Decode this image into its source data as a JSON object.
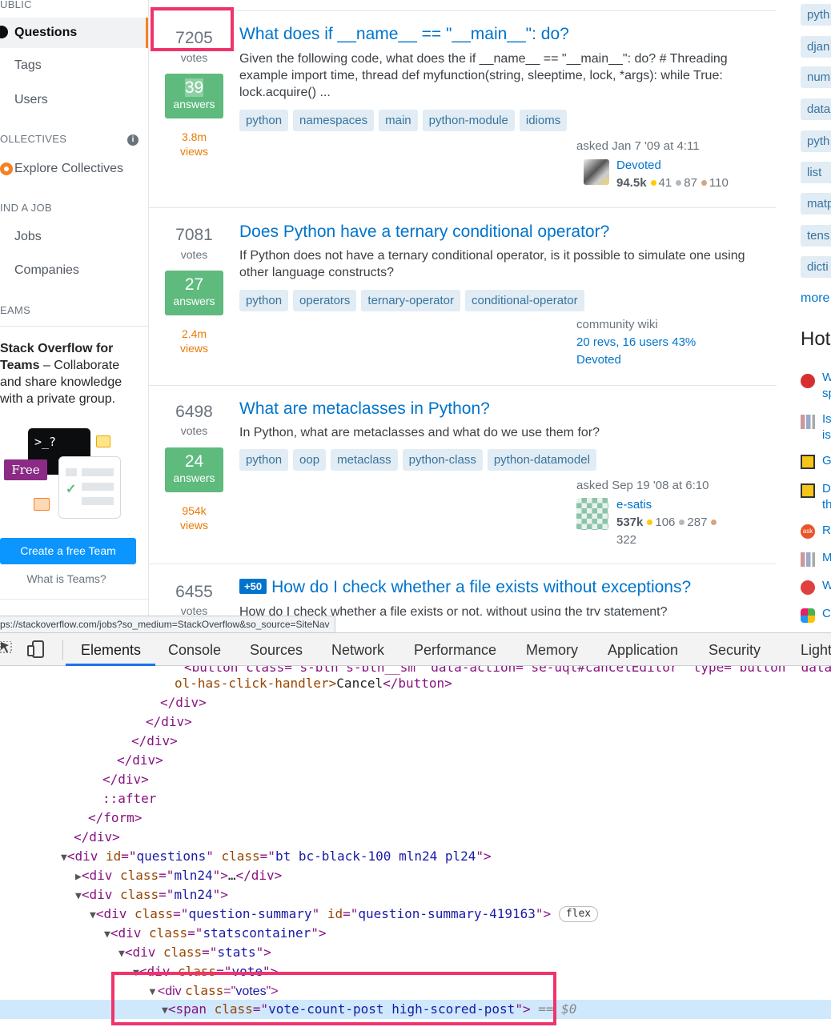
{
  "sidebar": {
    "public_label": "UBLIC",
    "questions": "Questions",
    "tags": "Tags",
    "users": "Users",
    "collectives_label": "OLLECTIVES",
    "explore_collectives": "Explore Collectives",
    "find_job_label": "IND A JOB",
    "jobs": "Jobs",
    "companies": "Companies",
    "teams_label": "EAMS",
    "teams_title_bold1": "Stack Overflow for",
    "teams_title_bold2": "Teams",
    "teams_title_rest": " – Collaborate and share knowledge with a private group.",
    "free_badge": "Free",
    "terminal_glyph": ">_?",
    "create_team": "Create a free Team",
    "what_is_teams": "What is Teams?"
  },
  "questions": [
    {
      "votes": "7205",
      "votes_label": "votes",
      "answers": "39",
      "answers_label": "answers",
      "views": "3.8m",
      "views_label": "views",
      "title": "What does if __name__ == \"__main__\": do?",
      "excerpt": "Given the following code, what does the if __name__ == \"__main__\": do? # Threading example import time, thread def myfunction(string, sleeptime, lock, *args): while True: lock.acquire() ...",
      "tags": [
        "python",
        "namespaces",
        "main",
        "python-module",
        "idioms"
      ],
      "asked": "asked Jan 7 '09 at 4:11",
      "user": "Devoted",
      "rep": "94.5k",
      "gold": "41",
      "silver": "87",
      "bronze": "110"
    },
    {
      "votes": "7081",
      "votes_label": "votes",
      "answers": "27",
      "answers_label": "answers",
      "views": "2.4m",
      "views_label": "views",
      "title": "Does Python have a ternary conditional operator?",
      "excerpt": "If Python does not have a ternary conditional operator, is it possible to simulate one using other language constructs?",
      "tags": [
        "python",
        "operators",
        "ternary-operator",
        "conditional-operator"
      ],
      "community": "community wiki",
      "revs": "20 revs, 16 users 43%",
      "user": "Devoted"
    },
    {
      "votes": "6498",
      "votes_label": "votes",
      "answers": "24",
      "answers_label": "answers",
      "views": "954k",
      "views_label": "views",
      "title": "What are metaclasses in Python?",
      "excerpt": "In Python, what are metaclasses and what do we use them for?",
      "tags": [
        "python",
        "oop",
        "metaclass",
        "python-class",
        "python-datamodel"
      ],
      "asked": "asked Sep 19 '08 at 6:10",
      "user": "e-satis",
      "rep": "537k",
      "gold": "106",
      "silver": "287",
      "bronze": "322"
    },
    {
      "votes": "6455",
      "votes_label": "votes",
      "bounty": "+50",
      "title": "How do I check whether a file exists without exceptions?",
      "excerpt": "How do I check whether a file exists or not, without using the try statement?"
    }
  ],
  "right": {
    "tags": [
      "pyth",
      "djan",
      "num",
      "data",
      "pyth",
      "list",
      "matp",
      "tens",
      "dicti"
    ],
    "more": "more",
    "hot_title": "Hot",
    "hot_items": [
      "W\nsp",
      "Is\nis",
      "G",
      "D\nth",
      "R",
      "M",
      "W",
      "C"
    ],
    "ask_glyph": "ask"
  },
  "url_status": "ps://stackoverflow.com/jobs?so_medium=StackOverflow&so_source=SiteNav",
  "devtools": {
    "tabs": [
      "Elements",
      "Console",
      "Sources",
      "Network",
      "Performance",
      "Memory",
      "Application",
      "Security",
      "Light"
    ],
    "lines": {
      "l0": "<button class=\"s-btn s-btn__sm\" data-action=\"se-uql#cancelEditor\" type=\"button\" data",
      "l1a": "ol-has-click-handler>",
      "l1b": "Cancel",
      "l1c": "</button>",
      "l2": "</div>",
      "l3": "</div>",
      "l4": "</div>",
      "l5": "</div>",
      "l6": "</div>",
      "l7": "::after",
      "l8": "</form>",
      "l9": "</div>",
      "q_id": "questions",
      "q_class": "bt bc-black-100 mln24 pl24",
      "mln1": "mln24",
      "mln1_ell": "…",
      "mln2": "mln24",
      "qs_class": "question-summary",
      "qs_id": "question-summary-419163",
      "flex": "flex",
      "sc_class": "statscontainer",
      "stats_class": "stats",
      "vote_class": "vote",
      "votes_class": "votes",
      "span_class": "vote-count-post high-scored-post",
      "sel_marker": "== $0"
    }
  },
  "colors": {
    "accent": "#f48225",
    "link": "#0074cc",
    "answered": "#5eba7d",
    "views": "#e87c08",
    "highlight": "#f0336b",
    "devtools_selected": "#cfe8fc"
  },
  "icons": [
    "stackoverflow-globe-icon",
    "info-icon",
    "collectives-icon",
    "terminal-icon",
    "chat-bubble-icon",
    "inspect-icon",
    "device-toggle-icon"
  ]
}
